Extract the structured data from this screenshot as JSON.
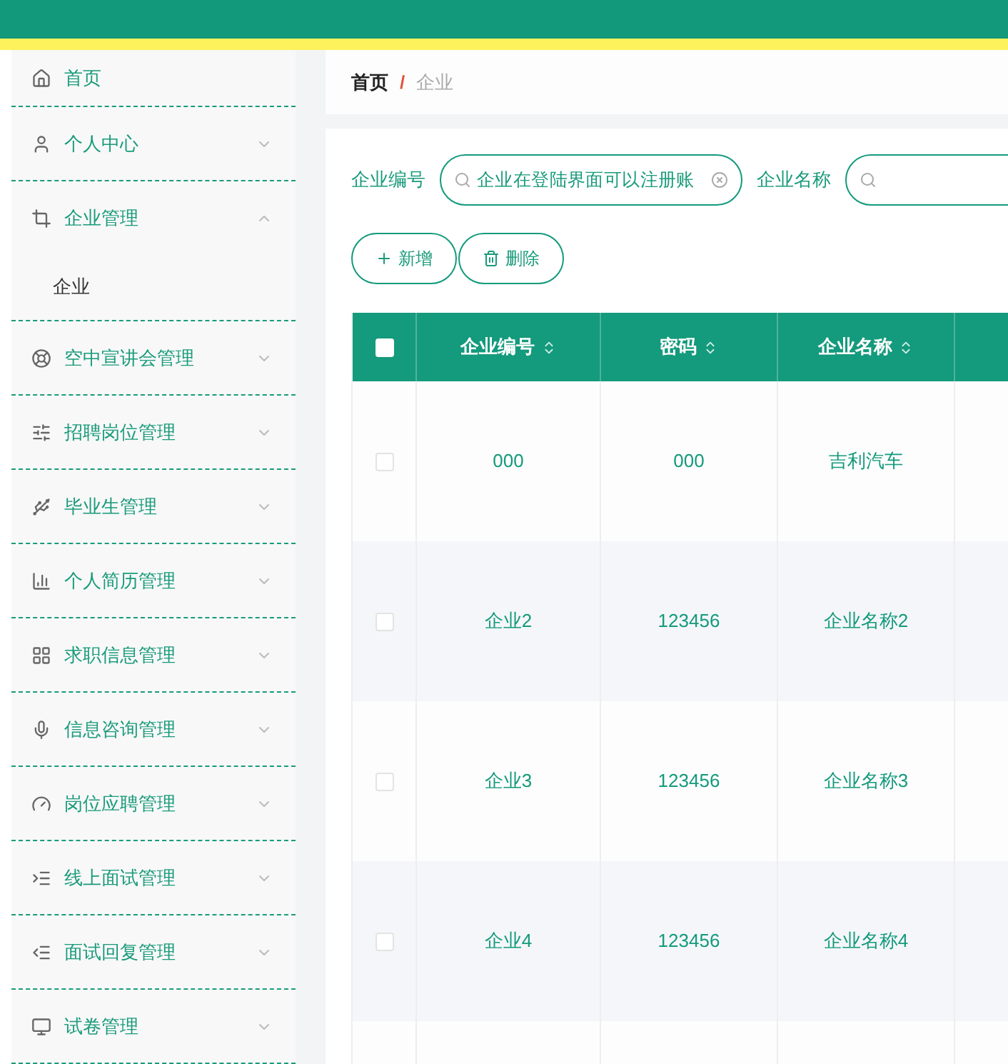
{
  "sidebar": {
    "items": [
      {
        "label": "首页",
        "kind": "link"
      },
      {
        "label": "个人中心",
        "kind": "menu",
        "expanded": false
      },
      {
        "label": "企业管理",
        "kind": "menu",
        "expanded": true,
        "children": [
          {
            "label": "企业"
          }
        ]
      },
      {
        "label": "空中宣讲会管理",
        "kind": "menu",
        "expanded": false
      },
      {
        "label": "招聘岗位管理",
        "kind": "menu",
        "expanded": false
      },
      {
        "label": "毕业生管理",
        "kind": "menu",
        "expanded": false
      },
      {
        "label": "个人简历管理",
        "kind": "menu",
        "expanded": false
      },
      {
        "label": "求职信息管理",
        "kind": "menu",
        "expanded": false
      },
      {
        "label": "信息咨询管理",
        "kind": "menu",
        "expanded": false
      },
      {
        "label": "岗位应聘管理",
        "kind": "menu",
        "expanded": false
      },
      {
        "label": "线上面试管理",
        "kind": "menu",
        "expanded": false
      },
      {
        "label": "面试回复管理",
        "kind": "menu",
        "expanded": false
      },
      {
        "label": "试卷管理",
        "kind": "menu",
        "expanded": false
      }
    ]
  },
  "breadcrumb": {
    "separator": "/",
    "items": [
      {
        "label": "首页",
        "current": false
      },
      {
        "label": "企业",
        "current": true
      }
    ]
  },
  "search": [
    {
      "label": "企业编号",
      "value": "企业在登陆界面可以注册账"
    },
    {
      "label": "企业名称"
    }
  ],
  "buttons": [
    {
      "label": "新增",
      "kind": "add"
    },
    {
      "label": "删除",
      "kind": "delete"
    }
  ],
  "table": {
    "select_all": {
      "checked": false
    },
    "columns": [
      {
        "label": "企业编号",
        "sortable": true
      },
      {
        "label": "密码",
        "sortable": true
      },
      {
        "label": "企业名称",
        "sortable": true
      }
    ],
    "rows": [
      {
        "checked": false,
        "cells": [
          "000",
          "000",
          "吉利汽车"
        ]
      },
      {
        "checked": false,
        "cells": [
          "企业2",
          "123456",
          "企业名称2"
        ]
      },
      {
        "checked": false,
        "cells": [
          "企业3",
          "123456",
          "企业名称3"
        ]
      },
      {
        "checked": false,
        "cells": [
          "企业4",
          "123456",
          "企业名称4"
        ]
      }
    ]
  }
}
